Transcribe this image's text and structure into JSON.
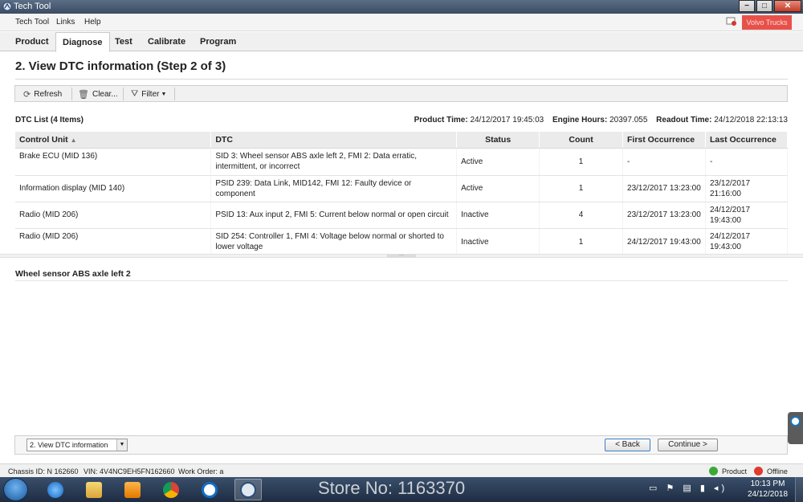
{
  "window": {
    "title": "Tech Tool",
    "close_label": "✕",
    "min_label": "−",
    "max_label": "□"
  },
  "menu": {
    "items": [
      "Tech Tool",
      "Links",
      "Help"
    ],
    "brand": "Volvo Trucks"
  },
  "tabs": [
    {
      "label": "Product",
      "active": false
    },
    {
      "label": "Diagnose",
      "active": true
    },
    {
      "label": "Test",
      "active": false
    },
    {
      "label": "Calibrate",
      "active": false
    },
    {
      "label": "Program",
      "active": false
    }
  ],
  "page": {
    "title": "2. View DTC information (Step 2 of 3)"
  },
  "toolbar": {
    "refresh": "Refresh",
    "clear": "Clear...",
    "filter": "Filter"
  },
  "dtc_list": {
    "title": "DTC List (4 Items)",
    "product_time_label": "Product Time:",
    "product_time": "24/12/2017 19:45:03",
    "engine_hours_label": "Engine Hours:",
    "engine_hours": "20397.055",
    "readout_time_label": "Readout Time:",
    "readout_time": "24/12/2018 22:13:13",
    "columns": [
      "Control Unit",
      "DTC",
      "Status",
      "Count",
      "First Occurrence",
      "Last Occurrence"
    ],
    "rows": [
      {
        "unit": "Brake ECU (MID 136)",
        "dtc": "SID 3: Wheel sensor ABS axle  left 2, FMI 2: Data erratic, intermittent, or incorrect",
        "status": "Active",
        "count": "1",
        "first": "-",
        "last": "-"
      },
      {
        "unit": "Information display (MID 140)",
        "dtc": "PSID 239: Data Link, MID142, FMI 12: Faulty device or component",
        "status": "Active",
        "count": "1",
        "first": "23/12/2017 13:23:00",
        "last": "23/12/2017 21:16:00"
      },
      {
        "unit": "Radio (MID 206)",
        "dtc": "PSID 13: Aux input 2, FMI 5: Current below normal or open circuit",
        "status": "Inactive",
        "count": "4",
        "first": "23/12/2017 13:23:00",
        "last": "24/12/2017 19:43:00"
      },
      {
        "unit": "Radio (MID 206)",
        "dtc": "SID 254: Controller 1, FMI 4: Voltage below normal or shorted to lower voltage",
        "status": "Inactive",
        "count": "1",
        "first": "24/12/2017 19:43:00",
        "last": "24/12/2017 19:43:00"
      }
    ]
  },
  "detail": {
    "title": "Wheel sensor ABS axle  left 2"
  },
  "footer": {
    "step_select": "2. View DTC information",
    "back": "< Back",
    "continue": "Continue >"
  },
  "status": {
    "chassis": "Chassis ID: N 162660",
    "vin": "VIN: 4V4NC9EH5FN162660",
    "work_order": "Work Order: a",
    "product": "Product",
    "offline": "Offline"
  },
  "taskbar": {
    "watermark": "Store No: 1163370",
    "time": "10:13 PM",
    "date": "24/12/2018"
  },
  "colors": {
    "brand": "#e8514a",
    "status_ok": "#3aaa35",
    "status_off": "#e03a2c",
    "taskbar": "#2a3b55"
  }
}
